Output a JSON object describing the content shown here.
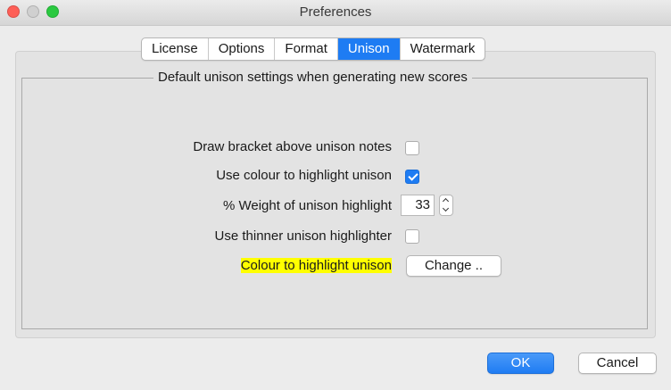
{
  "window": {
    "title": "Preferences"
  },
  "tabs": [
    {
      "label": "License",
      "active": false
    },
    {
      "label": "Options",
      "active": false
    },
    {
      "label": "Format",
      "active": false
    },
    {
      "label": "Unison",
      "active": true
    },
    {
      "label": "Watermark",
      "active": false
    }
  ],
  "group": {
    "title": "Default unison settings when generating new scores"
  },
  "settings": {
    "draw_bracket": {
      "label": "Draw bracket above unison notes",
      "checked": false
    },
    "use_colour": {
      "label": "Use colour to highlight unison",
      "checked": true
    },
    "weight": {
      "label": "% Weight of unison highlight",
      "value": "33"
    },
    "thinner": {
      "label": "Use thinner unison highlighter",
      "checked": false
    },
    "colour": {
      "label": "Colour to highlight unison",
      "highlight_color": "#ffff00",
      "button_label": "Change .."
    }
  },
  "footer": {
    "ok_label": "OK",
    "cancel_label": "Cancel"
  },
  "colors": {
    "accent": "#1e7cf3",
    "close": "#fe5f57",
    "zoom": "#2ac940"
  }
}
